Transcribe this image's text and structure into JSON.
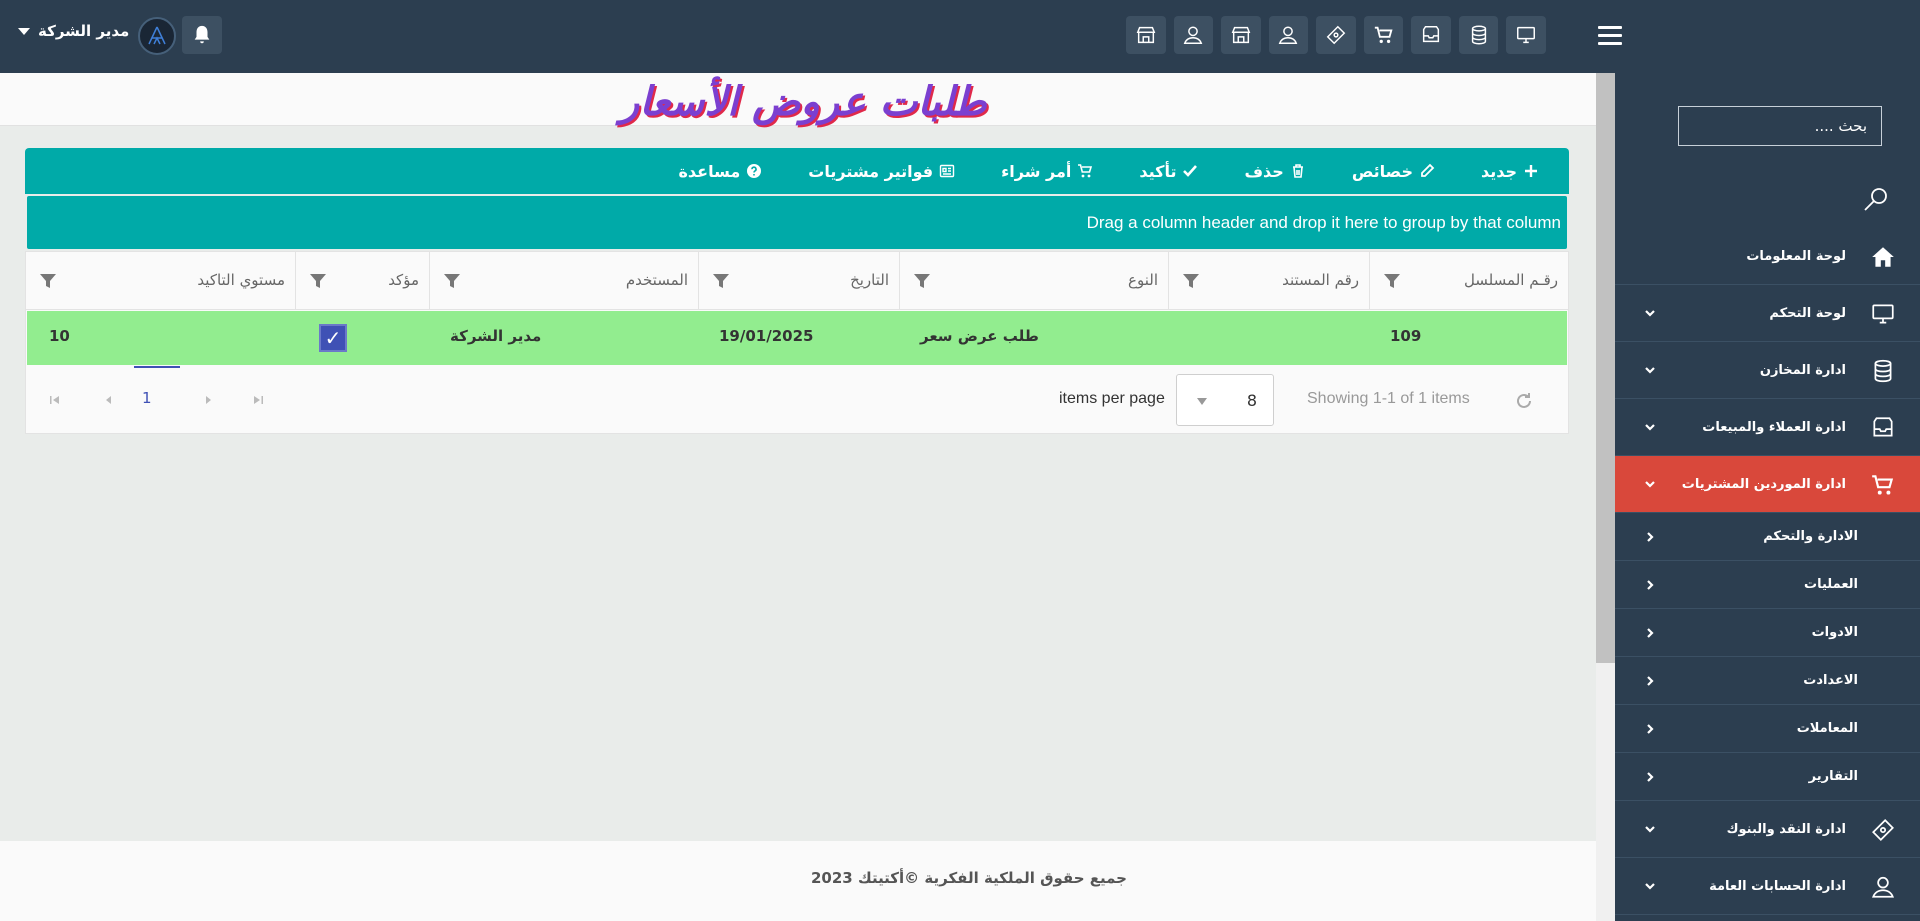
{
  "user": {
    "name": "مدير الشركة"
  },
  "top_icons": [
    "monitor-icon",
    "database-icon",
    "inbox-icon",
    "cart-icon",
    "ticket-icon",
    "user-icon",
    "store-icon",
    "user-icon",
    "store-icon"
  ],
  "sidebar": {
    "search_placeholder": "بحث ....",
    "items": [
      {
        "label": "لوحة المعلومات",
        "icon": "home-icon",
        "chevron": false
      },
      {
        "label": "لوحة التحكم",
        "icon": "monitor-icon",
        "chevron": true
      },
      {
        "label": "ادارة المخازن",
        "icon": "database-icon",
        "chevron": true
      },
      {
        "label": "ادارة العملاء والمبيعات",
        "icon": "inbox-icon",
        "chevron": true
      },
      {
        "label": "ادارة الموردين المشتريات",
        "icon": "cart-icon",
        "chevron": true,
        "active": true
      }
    ],
    "subitems": [
      "الادارة والتحكم",
      "العمليات",
      "الادوات",
      "الاعدادت",
      "المعاملات",
      "التقارير"
    ],
    "items_after": [
      {
        "label": "ادارة النقد والبنوك",
        "icon": "ticket-icon"
      },
      {
        "label": "ادارة الحسابات العامة",
        "icon": "user-icon"
      }
    ],
    "active_color": "#d9483b"
  },
  "page": {
    "title": "طلبات عروض الأسعار"
  },
  "toolbar": {
    "new": "جديد",
    "properties": "خصائص",
    "delete": "حذف",
    "confirm": "تأكيد",
    "purchase_order": "أمر شراء",
    "purchase_invoices": "فواتير مشتريات",
    "help": "مساعدة"
  },
  "grid": {
    "group_hint": "Drag a column header and drop it here to group by that column",
    "columns": [
      "رقـم المسلسل",
      "رقم المستند",
      "النوع",
      "التاريخ",
      "المستخدم",
      "مؤكد",
      "مستوي التاكيد"
    ],
    "rows": [
      {
        "serial": "109",
        "doc_no": "",
        "type": "طلب عرض سعر",
        "date": "19/01/2025",
        "user": "مدير الشركة",
        "confirmed": true,
        "confirm_level": "10"
      }
    ],
    "row_color": "#92ed8f"
  },
  "pager": {
    "current_page": "1",
    "items_per_page": "8",
    "items_per_page_label": "items per page",
    "showing": "Showing 1-1 of 1 items"
  },
  "footer": {
    "copyright": "جميع حقوق الملكية الفكرية ©أكتيتك 2023"
  },
  "colors": {
    "topbar": "#2c3e50",
    "toolbar": "#00aaa8",
    "title": "#7b3fd0",
    "title_shadow": "#e0294a"
  }
}
